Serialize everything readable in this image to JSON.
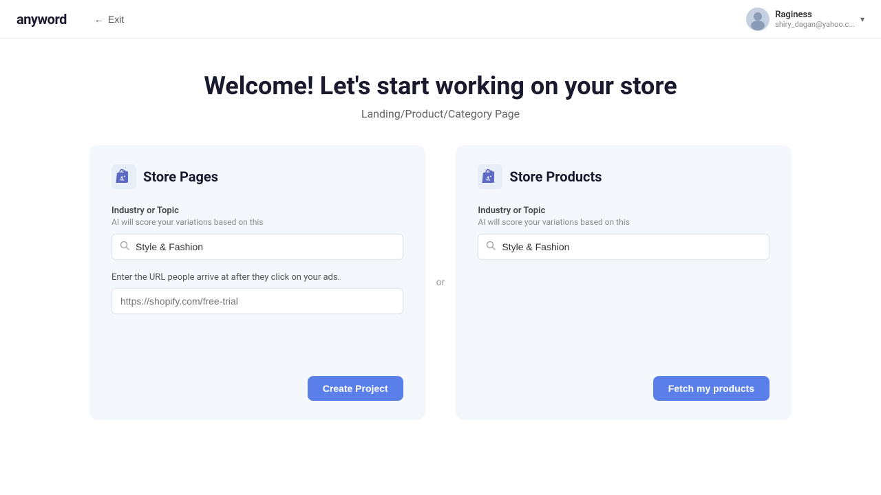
{
  "header": {
    "logo": "anyword",
    "exit_label": "Exit",
    "user": {
      "name": "Raginess",
      "email": "shiry_dagan@yahoo.c..."
    }
  },
  "main": {
    "title": "Welcome! Let's start working on your store",
    "subtitle": "Landing/Product/Category Page",
    "or_label": "or",
    "store_pages_card": {
      "title": "Store Pages",
      "industry_label": "Industry or Topic",
      "industry_sublabel": "AI will score your variations based on this",
      "industry_value": "Style & Fashion",
      "url_label": "Enter the URL people arrive at after they click on your ads.",
      "url_placeholder": "https://shopify.com/free-trial",
      "create_btn": "Create Project"
    },
    "store_products_card": {
      "title": "Store Products",
      "industry_label": "Industry or Topic",
      "industry_sublabel": "AI will score your variations based on this",
      "industry_value": "Style & Fashion",
      "fetch_btn": "Fetch my products"
    }
  },
  "icons": {
    "back_arrow": "←",
    "search": "🔍",
    "chevron_down": "▾"
  }
}
